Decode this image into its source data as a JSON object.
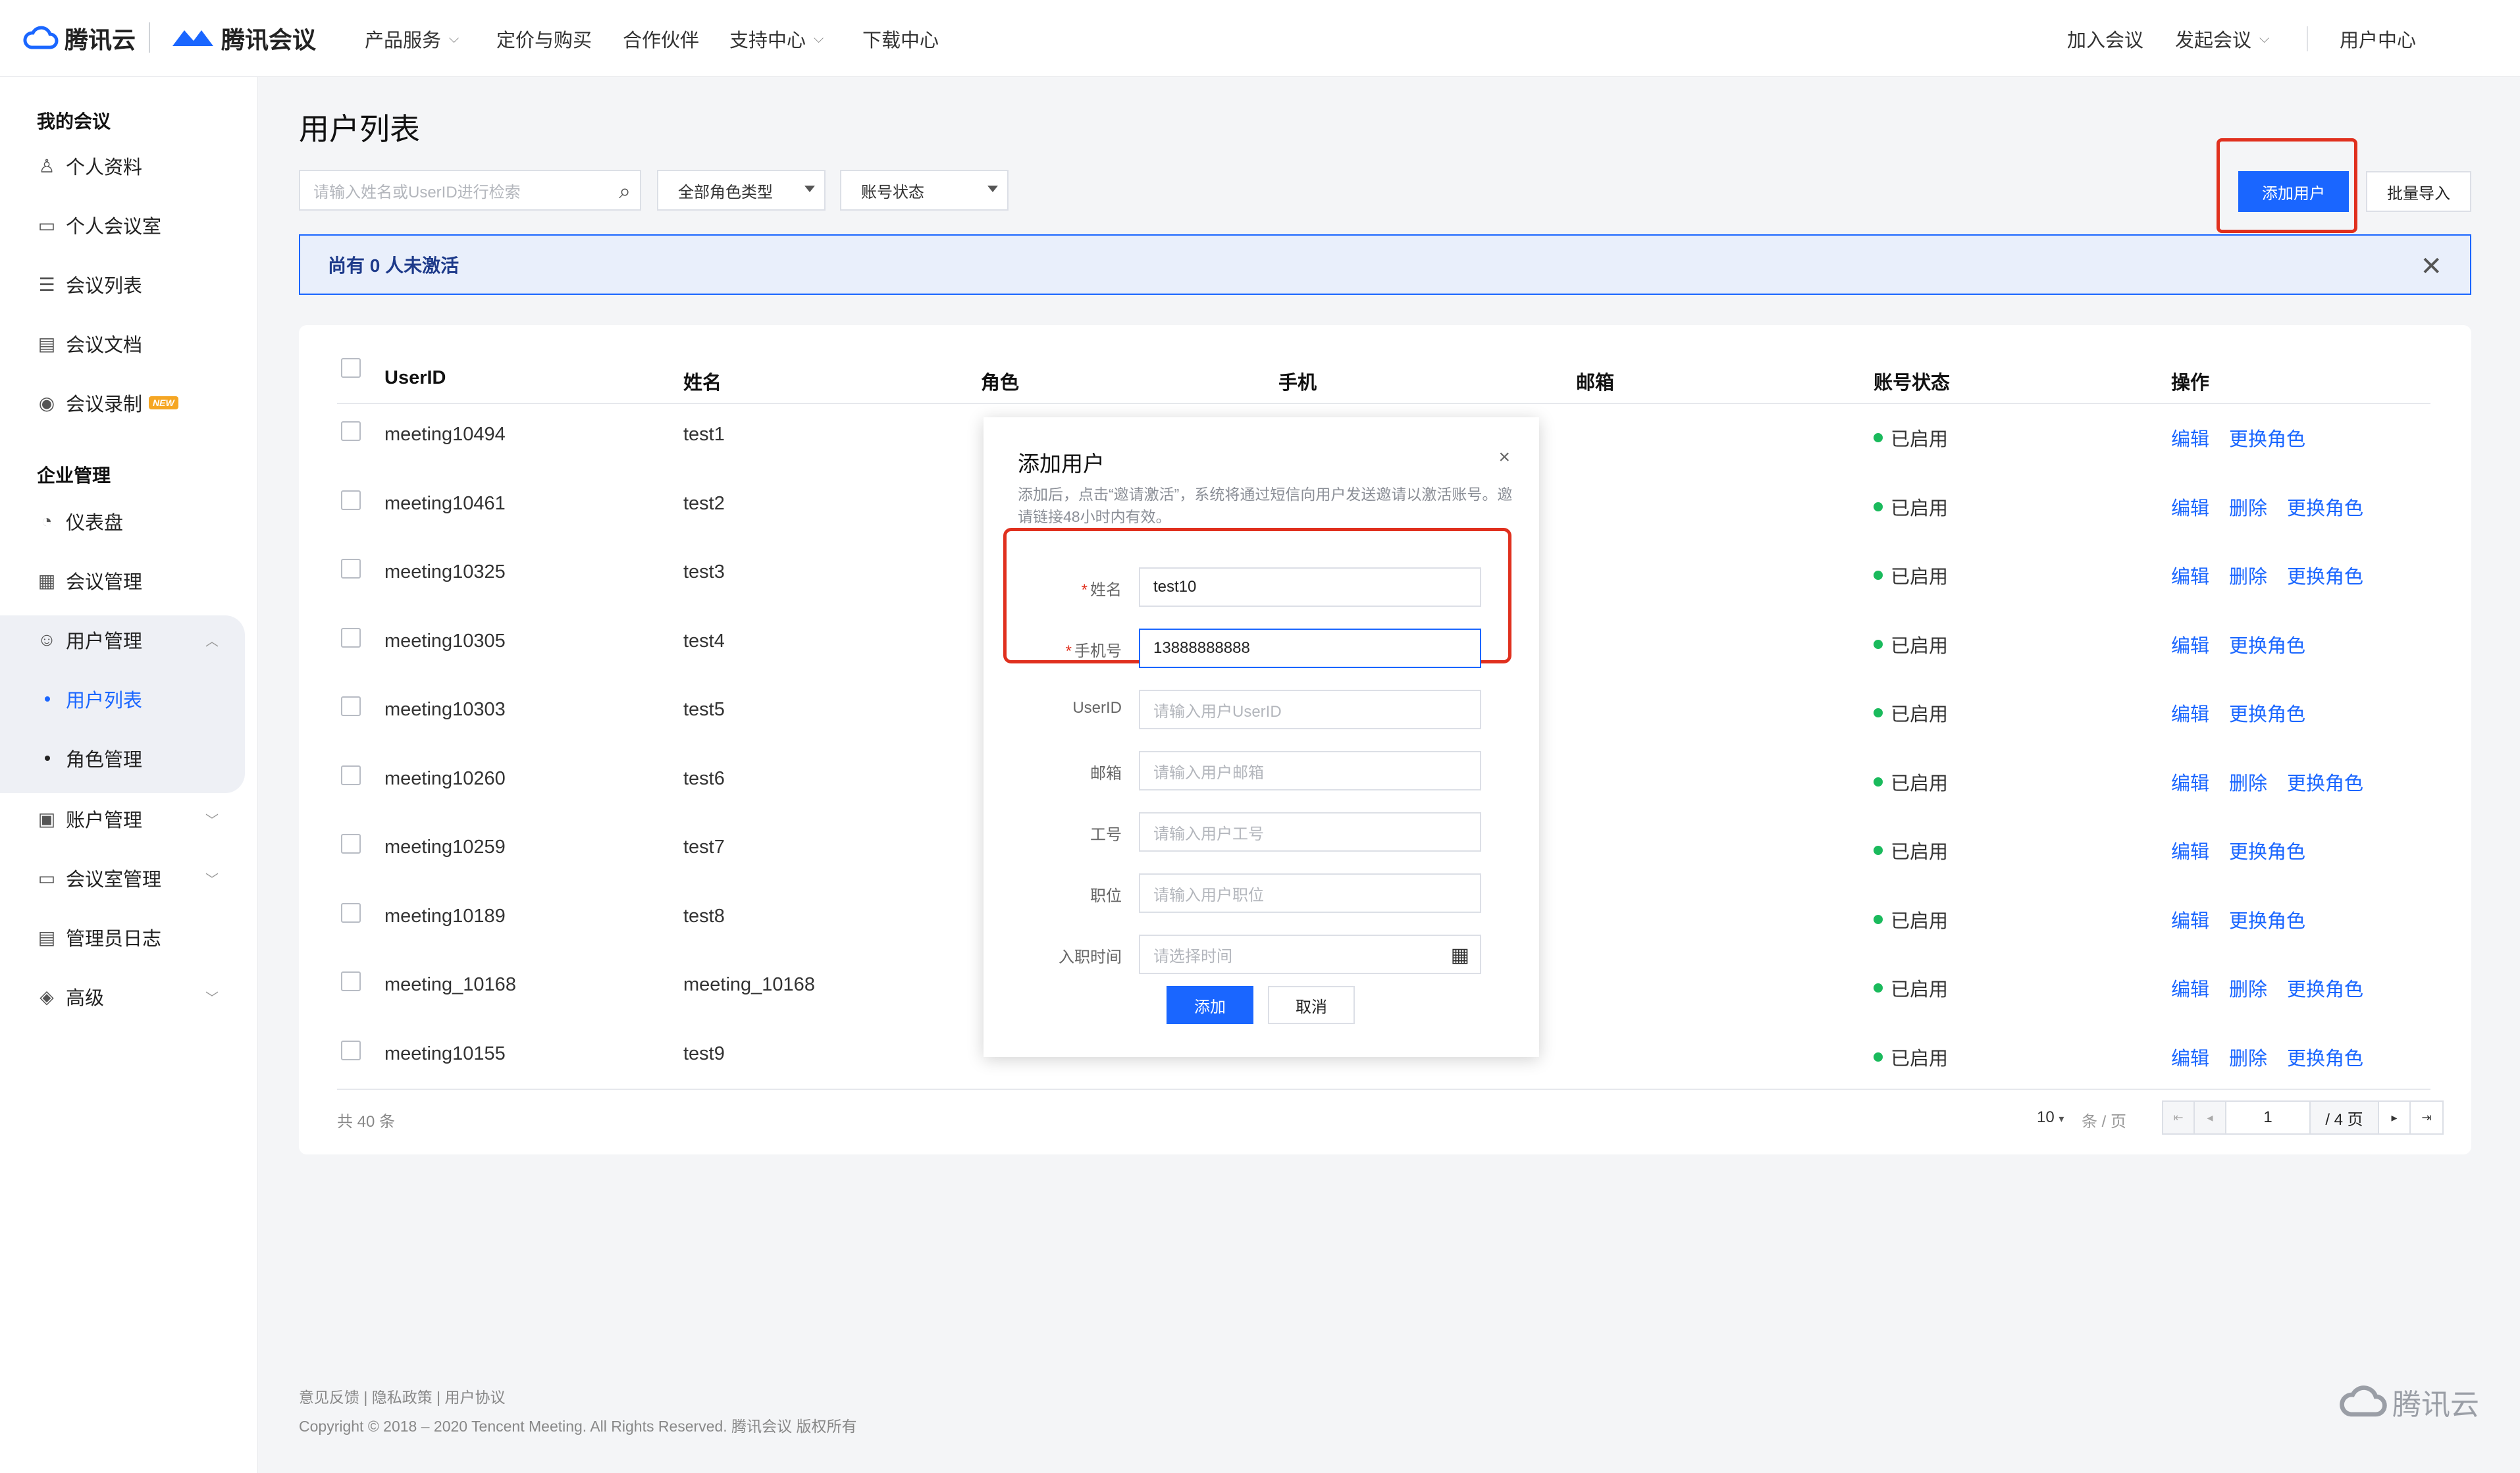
{
  "topbar": {
    "brand_cloud": "腾讯云",
    "brand_meeting": "腾讯会议",
    "nav": [
      {
        "label": "产品服务",
        "dropdown": true
      },
      {
        "label": "定价与购买",
        "dropdown": false
      },
      {
        "label": "合作伙伴",
        "dropdown": false
      },
      {
        "label": "支持中心",
        "dropdown": true
      },
      {
        "label": "下载中心",
        "dropdown": false
      }
    ],
    "right": [
      {
        "label": "加入会议"
      },
      {
        "label": "发起会议"
      },
      {
        "label": "用户中心"
      }
    ]
  },
  "sidebar": {
    "section_my": "我的会议",
    "my_items": [
      {
        "label": "个人资料",
        "icon": "user-icon"
      },
      {
        "label": "个人会议室",
        "icon": "meeting-room-icon"
      },
      {
        "label": "会议列表",
        "icon": "list-icon"
      },
      {
        "label": "会议文档",
        "icon": "document-icon"
      },
      {
        "label": "会议录制",
        "icon": "record-icon",
        "badge": "NEW"
      }
    ],
    "section_ent": "企业管理",
    "ent_items": [
      {
        "label": "仪表盘",
        "icon": "dashboard-icon"
      },
      {
        "label": "会议管理",
        "icon": "grid-icon"
      },
      {
        "label": "用户管理",
        "icon": "user-manage-icon"
      },
      {
        "label": "用户列表"
      },
      {
        "label": "角色管理"
      },
      {
        "label": "账户管理",
        "icon": "account-icon"
      },
      {
        "label": "会议室管理",
        "icon": "room-manage-icon"
      },
      {
        "label": "管理员日志",
        "icon": "log-icon"
      },
      {
        "label": "高级",
        "icon": "advanced-icon"
      }
    ]
  },
  "main": {
    "title": "用户列表",
    "search_placeholder": "请输入姓名或UserID进行检索",
    "role_filter": "全部角色类型",
    "status_filter": "账号状态",
    "add_user": "添加用户",
    "batch_import": "批量导入",
    "notice": "尚有 0 人未激活"
  },
  "table": {
    "headers": [
      "UserID",
      "姓名",
      "角色",
      "手机",
      "邮箱",
      "账号状态",
      "操作"
    ],
    "rows": [
      {
        "userid": "meeting10494",
        "name": "test1",
        "status": "已启用",
        "actions": [
          "编辑",
          "更换角色"
        ]
      },
      {
        "userid": "meeting10461",
        "name": "test2",
        "status": "已启用",
        "actions": [
          "编辑",
          "删除",
          "更换角色"
        ]
      },
      {
        "userid": "meeting10325",
        "name": "test3",
        "status": "已启用",
        "actions": [
          "编辑",
          "删除",
          "更换角色"
        ]
      },
      {
        "userid": "meeting10305",
        "name": "test4",
        "status": "已启用",
        "actions": [
          "编辑",
          "更换角色"
        ]
      },
      {
        "userid": "meeting10303",
        "name": "test5",
        "status": "已启用",
        "actions": [
          "编辑",
          "更换角色"
        ]
      },
      {
        "userid": "meeting10260",
        "name": "test6",
        "status": "已启用",
        "actions": [
          "编辑",
          "删除",
          "更换角色"
        ]
      },
      {
        "userid": "meeting10259",
        "name": "test7",
        "status": "已启用",
        "actions": [
          "编辑",
          "更换角色"
        ]
      },
      {
        "userid": "meeting10189",
        "name": "test8",
        "status": "已启用",
        "actions": [
          "编辑",
          "更换角色"
        ]
      },
      {
        "userid": "meeting_10168",
        "name": "meeting_10168",
        "status": "已启用",
        "actions": [
          "编辑",
          "删除",
          "更换角色"
        ]
      },
      {
        "userid": "meeting10155",
        "name": "test9",
        "status": "已启用",
        "actions": [
          "编辑",
          "删除",
          "更换角色"
        ]
      }
    ],
    "total": "共 40 条",
    "page_size": "10",
    "page_size_unit": "条 / 页",
    "current_page": "1",
    "total_pages": "/ 4 页"
  },
  "modal": {
    "title": "添加用户",
    "desc": "添加后，点击“邀请激活”，系统将通过短信向用户发送邀请以激活账号。邀请链接48小时内有效。",
    "fields": [
      {
        "label": "姓名",
        "required": true,
        "value": "test10",
        "placeholder": ""
      },
      {
        "label": "手机号",
        "required": true,
        "value": "13888888888",
        "placeholder": ""
      },
      {
        "label": "UserID",
        "required": false,
        "value": "",
        "placeholder": "请输入用户UserID"
      },
      {
        "label": "邮箱",
        "required": false,
        "value": "",
        "placeholder": "请输入用户邮箱"
      },
      {
        "label": "工号",
        "required": false,
        "value": "",
        "placeholder": "请输入用户工号"
      },
      {
        "label": "职位",
        "required": false,
        "value": "",
        "placeholder": "请输入用户职位"
      },
      {
        "label": "入职时间",
        "required": false,
        "value": "",
        "placeholder": "请选择时间"
      }
    ],
    "ok": "添加",
    "cancel": "取消"
  },
  "footer": {
    "links": "意见反馈 | 隐私政策 | 用户协议",
    "copyright": "Copyright © 2018 – 2020 Tencent Meeting. All Rights Reserved. 腾讯会议 版权所有",
    "logo_text": "腾讯云"
  },
  "colors": {
    "accent": "#1a66ff",
    "highlight": "#e0301e",
    "status_ok": "#1aba5c"
  }
}
